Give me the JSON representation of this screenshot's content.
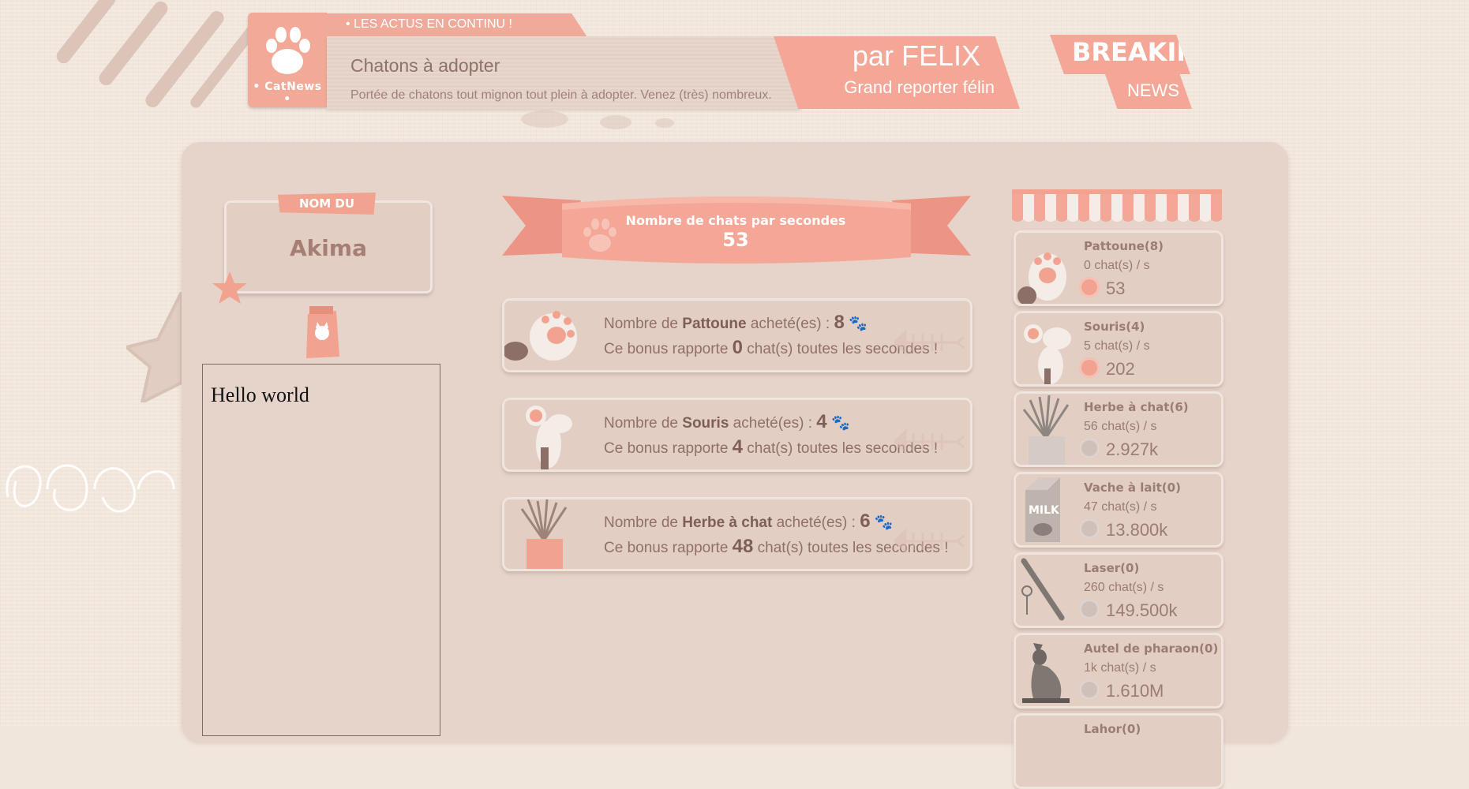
{
  "ticker": {
    "label": "•   LES ACTUS EN CONTINU !",
    "brand": "• CatNews •",
    "title": "Chatons à adopter",
    "description": "Portée de chatons tout mignon tout plein à adopter. Venez (très) nombreux.",
    "author": "par FELIX",
    "author_role": "Grand reporter félin",
    "breaking": "BREAKING",
    "news": "NEWS"
  },
  "shelter": {
    "label": "NOM DU REFUGE",
    "name": "Akima"
  },
  "output_box": {
    "text": "Hello world"
  },
  "counter": {
    "label": "Nombre de chats par secondes",
    "value": "53"
  },
  "bonuses": [
    {
      "prefix": "Nombre de ",
      "name": "Pattoune",
      "suffix": " acheté(es) : ",
      "count": "8",
      "l2_prefix": "Ce bonus rapporte ",
      "rate": "0",
      "l2_suffix": " chat(s) toutes les secondes !"
    },
    {
      "prefix": "Nombre de ",
      "name": "Souris",
      "suffix": " acheté(es) : ",
      "count": "4",
      "l2_prefix": "Ce bonus rapporte ",
      "rate": "4",
      "l2_suffix": " chat(s) toutes les secondes !"
    },
    {
      "prefix": "Nombre de ",
      "name": "Herbe à chat",
      "suffix": " acheté(es) : ",
      "count": "6",
      "l2_prefix": "Ce bonus rapporte ",
      "rate": "48",
      "l2_suffix": " chat(s) toutes les secondes !"
    }
  ],
  "shop": [
    {
      "name": "Pattoune(8)",
      "rate": "0 chat(s) / s",
      "price": "53",
      "affordable": true
    },
    {
      "name": "Souris(4)",
      "rate": "5 chat(s) / s",
      "price": "202",
      "affordable": true
    },
    {
      "name": "Herbe à chat(6)",
      "rate": "56 chat(s) / s",
      "price": "2.927k",
      "affordable": false
    },
    {
      "name": "Vache à lait(0)",
      "rate": "47 chat(s) / s",
      "price": "13.800k",
      "affordable": false
    },
    {
      "name": "Laser(0)",
      "rate": "260 chat(s) / s",
      "price": "149.500k",
      "affordable": false
    },
    {
      "name": "Autel de pharaon(0)",
      "rate": "1k chat(s) / s",
      "price": "1.610M",
      "affordable": false
    },
    {
      "name": "Lahor(0)",
      "rate": "",
      "price": "",
      "affordable": false
    }
  ],
  "colors": {
    "accent": "#f4a796",
    "panel": "#e6d4ca",
    "text": "#8f7068"
  }
}
